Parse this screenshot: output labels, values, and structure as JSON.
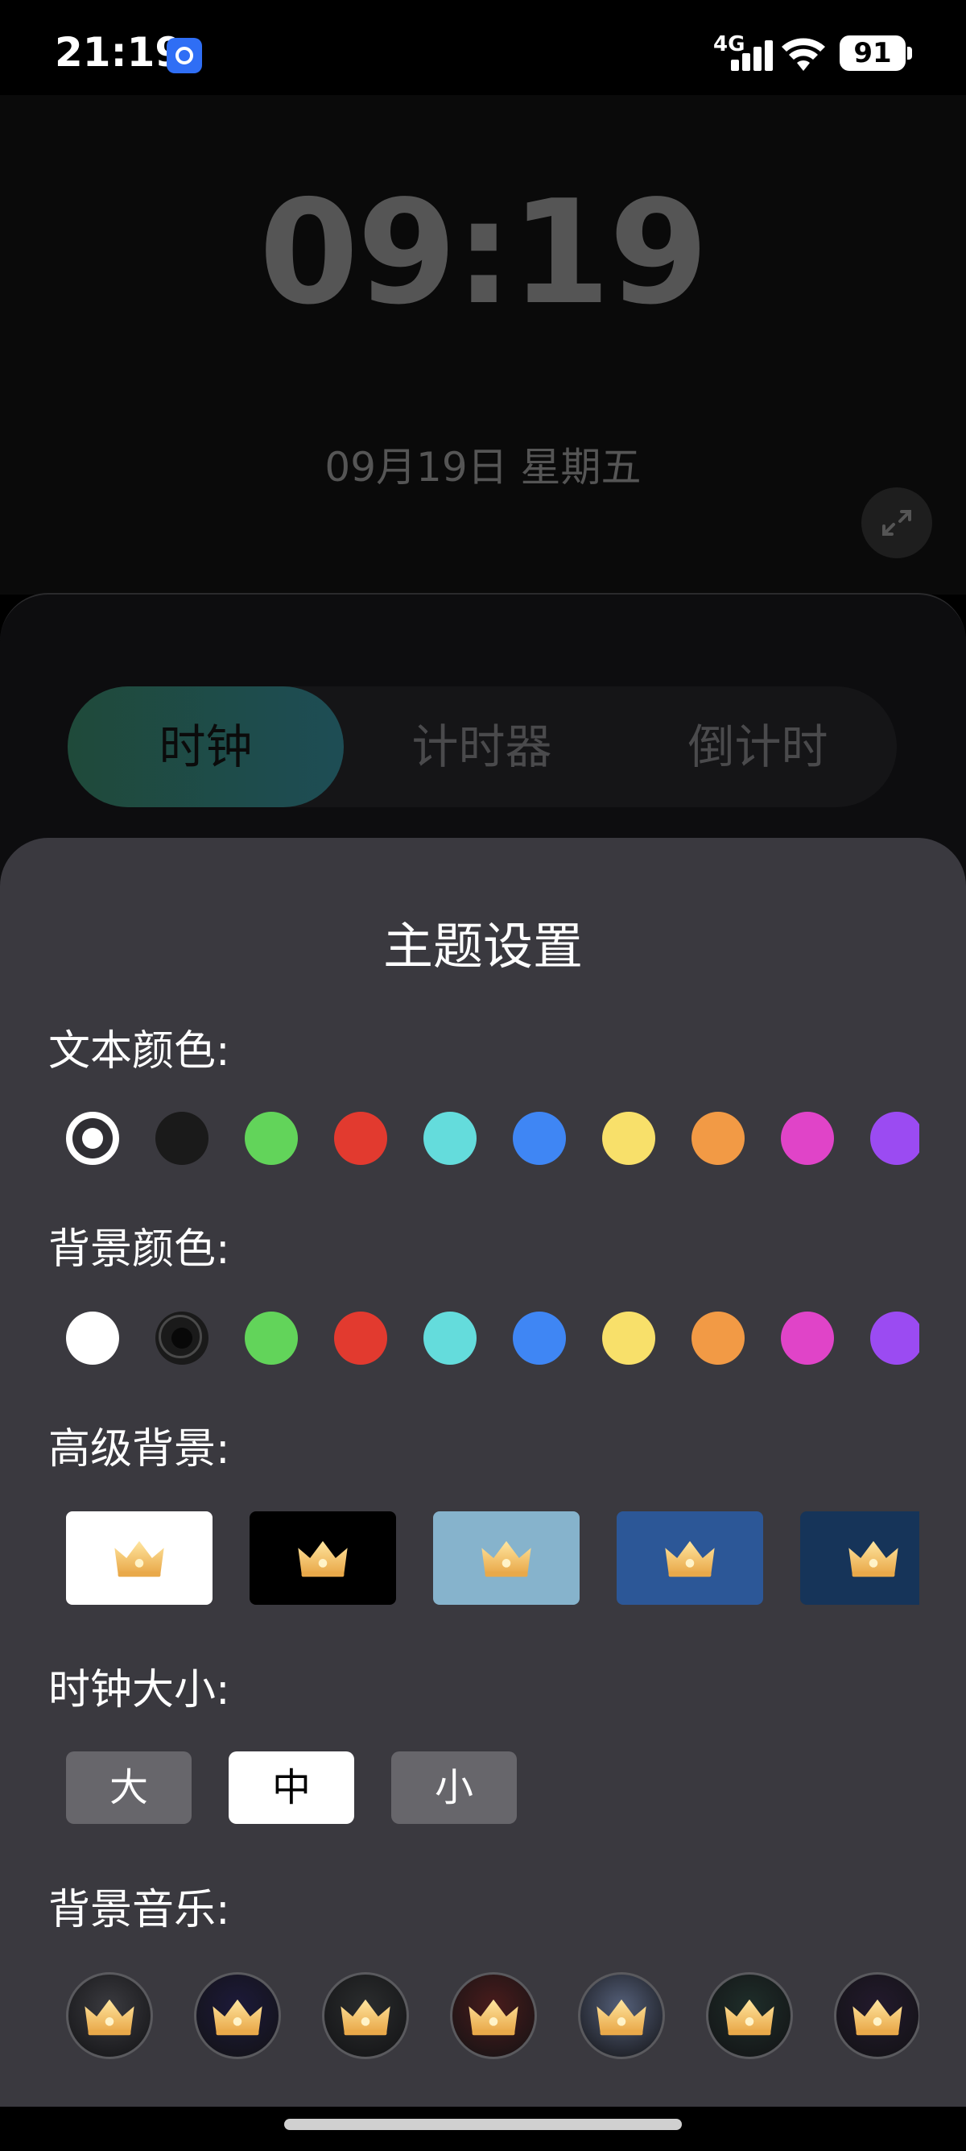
{
  "status_bar": {
    "time": "21:19",
    "network": "4G",
    "battery": "91"
  },
  "clock": {
    "time": "09:19",
    "date": "09月19日 星期五"
  },
  "tabs": [
    {
      "label": "时钟",
      "active": true
    },
    {
      "label": "计时器",
      "active": false
    },
    {
      "label": "倒计时",
      "active": false
    }
  ],
  "sheet": {
    "title": "主题设置",
    "text_color_label": "文本颜色:",
    "bg_color_label": "背景颜色:",
    "advanced_bg_label": "高级背景:",
    "clock_size_label": "时钟大小:",
    "bg_music_label": "背景音乐:"
  },
  "text_colors": [
    "#ffffff",
    "#1a1a1a",
    "#62d45a",
    "#e23a2f",
    "#64dcdc",
    "#3f86f4",
    "#f8e06a",
    "#f29a45",
    "#e044c8",
    "#9b4bf2"
  ],
  "text_color_selected": 0,
  "bg_colors": [
    "#ffffff",
    "#1a1a1a",
    "#62d45a",
    "#e23a2f",
    "#64dcdc",
    "#3f86f4",
    "#f8e06a",
    "#f29a45",
    "#e044c8",
    "#9b4bf2"
  ],
  "bg_color_selected": 1,
  "advanced_backgrounds": [
    "#ffffff",
    "#000000",
    "#86b3cc",
    "#2c5797",
    "#163459"
  ],
  "clock_sizes": [
    {
      "label": "大",
      "active": false
    },
    {
      "label": "中",
      "active": true
    },
    {
      "label": "小",
      "active": false
    }
  ],
  "music_tracks": [
    "#3b3b40",
    "#1d1a3a",
    "#2b2d2e",
    "#4a1c1c",
    "#55607a",
    "#1f2e2a",
    "#231a2d"
  ],
  "icons": {
    "crown": "crown-icon",
    "expand": "expand-icon"
  }
}
